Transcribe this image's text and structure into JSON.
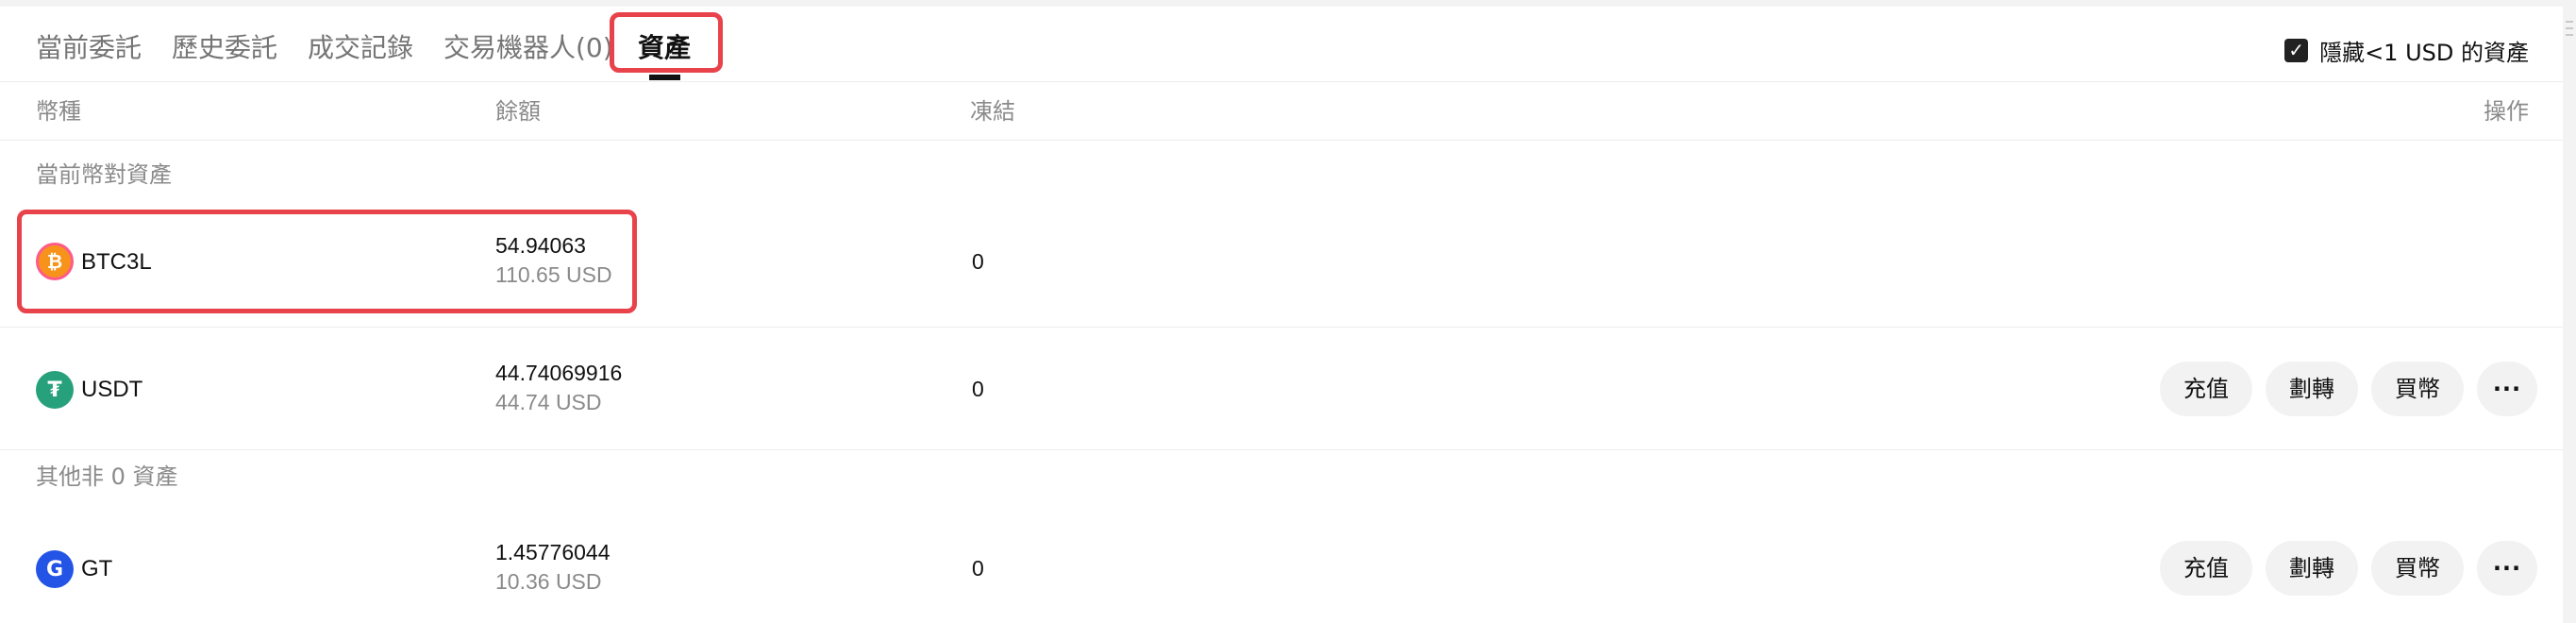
{
  "tabs": [
    {
      "label": "當前委託"
    },
    {
      "label": "歷史委託"
    },
    {
      "label": "成交記錄"
    },
    {
      "label": "交易機器人(0)"
    },
    {
      "label": "資產",
      "active": true
    }
  ],
  "hide_small": {
    "checked": true,
    "check_glyph": "✓",
    "label": "隱藏<1 USD 的資產"
  },
  "columns": {
    "currency": "幣種",
    "balance": "餘額",
    "frozen": "凍結",
    "actions": "操作"
  },
  "sections": {
    "current_pair": "當前幣對資產",
    "other_nonzero": "其他非 0 資產"
  },
  "assets": [
    {
      "name": "BTC3L",
      "icon": "btc3l-icon",
      "icon_glyph": "₿",
      "balance": "54.94063",
      "usd_value": "110.65 USD",
      "frozen": "0",
      "show_actions": false
    },
    {
      "name": "USDT",
      "icon": "tether-icon",
      "icon_glyph": "₮",
      "balance": "44.74069916",
      "usd_value": "44.74 USD",
      "frozen": "0",
      "show_actions": true
    },
    {
      "name": "GT",
      "icon": "gatetoken-icon",
      "icon_glyph": "G",
      "balance": "1.45776044",
      "usd_value": "10.36 USD",
      "frozen": "0",
      "show_actions": true
    }
  ],
  "actions": {
    "deposit": "充值",
    "transfer": "劃轉",
    "buy": "買幣",
    "more": "···"
  },
  "colors": {
    "highlight": "#e8434b",
    "tether": "#26a17b",
    "gatetoken": "#2354e6",
    "btc3l_outer": "#f7931a",
    "btc3l_inner": "#ff5a8a"
  }
}
